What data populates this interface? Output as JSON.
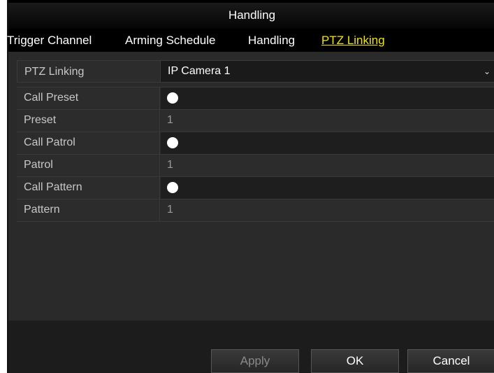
{
  "window": {
    "title": "Handling"
  },
  "tabs": [
    {
      "label": "Trigger Channel",
      "active": false
    },
    {
      "label": "Arming Schedule",
      "active": false
    },
    {
      "label": "Handling",
      "active": false
    },
    {
      "label": "PTZ Linking",
      "active": true
    }
  ],
  "ptz_linking": {
    "label": "PTZ Linking",
    "selected": "IP Camera 1",
    "dropdown_icon": "chevron-down-icon"
  },
  "rows": [
    {
      "label": "Call Preset",
      "type": "radio"
    },
    {
      "label": "Preset",
      "value": "1"
    },
    {
      "label": "Call Patrol",
      "type": "radio"
    },
    {
      "label": "Patrol",
      "value": "1"
    },
    {
      "label": "Call Pattern",
      "type": "radio"
    },
    {
      "label": "Pattern",
      "value": "1"
    }
  ],
  "buttons": {
    "apply": "Apply",
    "ok": "OK",
    "cancel": "Cancel"
  },
  "colors": {
    "active_tab": "#f2e600",
    "background": "#2a2a2a",
    "titlebar": "#000000"
  }
}
